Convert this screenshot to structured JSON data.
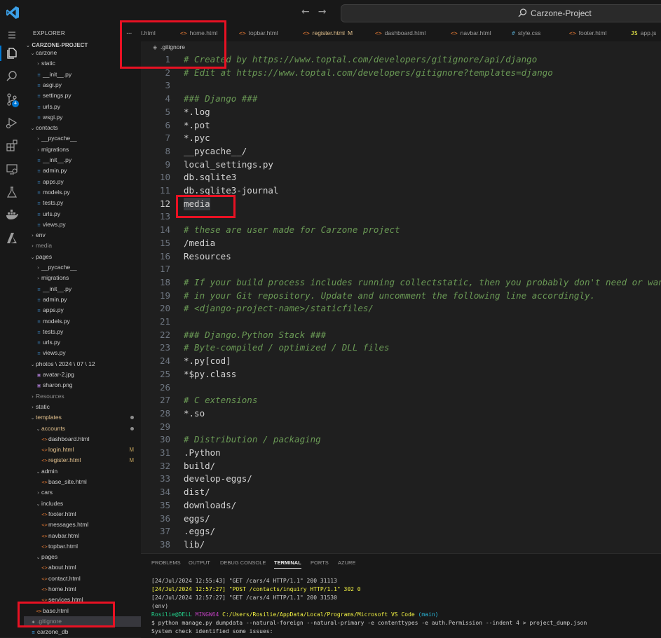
{
  "title_bar": {
    "search_text": "Carzone-Project",
    "back_icon": "arrow-left-icon",
    "forward_icon": "arrow-right-icon"
  },
  "activity_bar": [
    "menu-icon",
    "explorer-icon",
    "search-icon",
    "source-control-icon",
    "run-debug-icon",
    "extensions-icon",
    "remote-explorer-icon",
    "testing-icon",
    "docker-icon",
    "azure-icon"
  ],
  "source_control_badge": "4",
  "sidebar": {
    "title": "EXPLORER",
    "project": "CARZONE-PROJECT",
    "tree": [
      {
        "label": "carzone",
        "type": "folder",
        "open": true,
        "indent": 1
      },
      {
        "label": "static",
        "type": "folder",
        "open": false,
        "indent": 2
      },
      {
        "label": "__init__.py",
        "type": "py",
        "indent": 2
      },
      {
        "label": "asgi.py",
        "type": "py",
        "indent": 2
      },
      {
        "label": "settings.py",
        "type": "py",
        "indent": 2
      },
      {
        "label": "urls.py",
        "type": "py",
        "indent": 2
      },
      {
        "label": "wsgi.py",
        "type": "py",
        "indent": 2
      },
      {
        "label": "contacts",
        "type": "folder",
        "open": true,
        "indent": 1
      },
      {
        "label": "__pycache__",
        "type": "folder",
        "open": false,
        "indent": 2
      },
      {
        "label": "migrations",
        "type": "folder",
        "open": false,
        "indent": 2
      },
      {
        "label": "__init__.py",
        "type": "py",
        "indent": 2
      },
      {
        "label": "admin.py",
        "type": "py",
        "indent": 2
      },
      {
        "label": "apps.py",
        "type": "py",
        "indent": 2
      },
      {
        "label": "models.py",
        "type": "py",
        "indent": 2
      },
      {
        "label": "tests.py",
        "type": "py",
        "indent": 2
      },
      {
        "label": "urls.py",
        "type": "py",
        "indent": 2
      },
      {
        "label": "views.py",
        "type": "py",
        "indent": 2
      },
      {
        "label": "env",
        "type": "folder",
        "open": false,
        "indent": 1
      },
      {
        "label": "media",
        "type": "folder-dim",
        "open": false,
        "indent": 1
      },
      {
        "label": "pages",
        "type": "folder",
        "open": true,
        "indent": 1
      },
      {
        "label": "__pycache__",
        "type": "folder",
        "open": false,
        "indent": 2
      },
      {
        "label": "migrations",
        "type": "folder",
        "open": false,
        "indent": 2
      },
      {
        "label": "__init__.py",
        "type": "py",
        "indent": 2
      },
      {
        "label": "admin.py",
        "type": "py",
        "indent": 2
      },
      {
        "label": "apps.py",
        "type": "py",
        "indent": 2
      },
      {
        "label": "models.py",
        "type": "py",
        "indent": 2
      },
      {
        "label": "tests.py",
        "type": "py",
        "indent": 2
      },
      {
        "label": "urls.py",
        "type": "py",
        "indent": 2
      },
      {
        "label": "views.py",
        "type": "py",
        "indent": 2
      },
      {
        "label": "photos \\ 2024 \\ 07 \\ 12",
        "type": "folder",
        "open": true,
        "indent": 1
      },
      {
        "label": "avatar-2.jpg",
        "type": "img",
        "indent": 2
      },
      {
        "label": "sharon.png",
        "type": "img",
        "indent": 2
      },
      {
        "label": "Resources",
        "type": "folder-dim",
        "open": false,
        "indent": 1
      },
      {
        "label": "static",
        "type": "folder",
        "open": false,
        "indent": 1
      },
      {
        "label": "templates",
        "type": "folder-mod",
        "open": true,
        "indent": 1,
        "dot": true
      },
      {
        "label": "accounts",
        "type": "folder-mod",
        "open": true,
        "indent": 2,
        "dot": true
      },
      {
        "label": "dashboard.html",
        "type": "html",
        "indent": 3
      },
      {
        "label": "login.html",
        "type": "html-mod",
        "indent": 3,
        "mod": "M"
      },
      {
        "label": "register.html",
        "type": "html-mod",
        "indent": 3,
        "mod": "M"
      },
      {
        "label": "admin",
        "type": "folder",
        "open": true,
        "indent": 2
      },
      {
        "label": "base_site.html",
        "type": "html",
        "indent": 3
      },
      {
        "label": "cars",
        "type": "folder",
        "open": false,
        "indent": 2
      },
      {
        "label": "includes",
        "type": "folder",
        "open": true,
        "indent": 2
      },
      {
        "label": "footer.html",
        "type": "html",
        "indent": 3
      },
      {
        "label": "messages.html",
        "type": "html",
        "indent": 3
      },
      {
        "label": "navbar.html",
        "type": "html",
        "indent": 3
      },
      {
        "label": "topbar.html",
        "type": "html",
        "indent": 3
      },
      {
        "label": "pages",
        "type": "folder",
        "open": true,
        "indent": 2
      },
      {
        "label": "about.html",
        "type": "html",
        "indent": 3
      },
      {
        "label": "contact.html",
        "type": "html",
        "indent": 3
      },
      {
        "label": "home.html",
        "type": "html",
        "indent": 3
      },
      {
        "label": "services.html",
        "type": "html",
        "indent": 3
      },
      {
        "label": "base.html",
        "type": "html",
        "indent": 2
      },
      {
        "label": ".gitignore",
        "type": "git",
        "indent": 1,
        "selected": true
      },
      {
        "label": "carzone_db",
        "type": "db",
        "indent": 1
      }
    ]
  },
  "more_actions": "...",
  "tabs": [
    {
      "label": "t.html",
      "icon": "<>"
    },
    {
      "label": "home.html",
      "icon": "<>"
    },
    {
      "label": "topbar.html",
      "icon": "<>"
    },
    {
      "label": "register.html",
      "icon": "<>",
      "active": true,
      "badge": "M"
    },
    {
      "label": "dashboard.html",
      "icon": "<>"
    },
    {
      "label": "navbar.html",
      "icon": "<>"
    },
    {
      "label": "style.css",
      "icon": "#"
    },
    {
      "label": "footer.html",
      "icon": "<>"
    },
    {
      "label": "app.js",
      "icon": "JS"
    }
  ],
  "breadcrumb": ".gitignore",
  "editor": {
    "current_line": 12,
    "lines": [
      {
        "n": "1",
        "text": "# Created by https://www.toptal.com/developers/gitignore/api/django",
        "comment": true
      },
      {
        "n": "2",
        "text": "# Edit at https://www.toptal.com/developers/gitignore?templates=django",
        "comment": true
      },
      {
        "n": "3",
        "text": ""
      },
      {
        "n": "4",
        "text": "### Django ###",
        "comment": true
      },
      {
        "n": "5",
        "text": "*.log"
      },
      {
        "n": "6",
        "text": "*.pot"
      },
      {
        "n": "7",
        "text": "*.pyc"
      },
      {
        "n": "8",
        "text": "__pycache__/"
      },
      {
        "n": "9",
        "text": "local_settings.py"
      },
      {
        "n": "10",
        "text": "db.sqlite3"
      },
      {
        "n": "11",
        "text": "db.sqlite3-journal"
      },
      {
        "n": "12",
        "text": "media",
        "highlight": true
      },
      {
        "n": "13",
        "text": ""
      },
      {
        "n": "14",
        "text": "# these are user made for Carzone project",
        "comment": true
      },
      {
        "n": "15",
        "text": "/media"
      },
      {
        "n": "16",
        "text": "Resources"
      },
      {
        "n": "17",
        "text": ""
      },
      {
        "n": "18",
        "text": "# If your build process includes running collectstatic, then you probably don't need or want",
        "comment": true
      },
      {
        "n": "19",
        "text": "# in your Git repository. Update and uncomment the following line accordingly.",
        "comment": true
      },
      {
        "n": "20",
        "text": "# <django-project-name>/staticfiles/",
        "comment": true
      },
      {
        "n": "21",
        "text": ""
      },
      {
        "n": "22",
        "text": "### Django.Python Stack ###",
        "comment": true
      },
      {
        "n": "23",
        "text": "# Byte-compiled / optimized / DLL files",
        "comment": true
      },
      {
        "n": "24",
        "text": "*.py[cod]"
      },
      {
        "n": "25",
        "text": "*$py.class"
      },
      {
        "n": "26",
        "text": ""
      },
      {
        "n": "27",
        "text": "# C extensions",
        "comment": true
      },
      {
        "n": "28",
        "text": "*.so"
      },
      {
        "n": "29",
        "text": ""
      },
      {
        "n": "30",
        "text": "# Distribution / packaging",
        "comment": true
      },
      {
        "n": "31",
        "text": ".Python"
      },
      {
        "n": "32",
        "text": "build/"
      },
      {
        "n": "33",
        "text": "develop-eggs/"
      },
      {
        "n": "34",
        "text": "dist/"
      },
      {
        "n": "35",
        "text": "downloads/"
      },
      {
        "n": "36",
        "text": "eggs/"
      },
      {
        "n": "37",
        "text": ".eggs/"
      },
      {
        "n": "38",
        "text": "lib/"
      }
    ]
  },
  "panel": {
    "tabs": [
      "PROBLEMS",
      "OUTPUT",
      "DEBUG CONSOLE",
      "TERMINAL",
      "PORTS",
      "AZURE"
    ],
    "active_tab": "TERMINAL",
    "terminal": {
      "line1": "[24/Jul/2024 12:55:43] \"GET /cars/4 HTTP/1.1\" 200 31113",
      "line2": "[24/Jul/2024 12:57:27] \"POST /contacts/inquiry HTTP/1.1\" 302 0",
      "line3": "[24/Jul/2024 12:57:27] \"GET /cars/4 HTTP/1.1\" 200 31530",
      "line4": "(env)",
      "prompt_user": "Rosilie@DELL",
      "prompt_shell": "MINGW64",
      "prompt_path": "C:/Users/Rosilie/AppData/Local/Programs/Microsoft VS Code",
      "prompt_branch": "(main)",
      "command": "$ python manage.py dumpdata --natural-foreign --natural-primary -e contenttypes -e auth.Permission --indent 4 > project_dump.json",
      "output": "System check identified some issues:"
    }
  },
  "colors": {
    "accent": "#0078d4",
    "annotation": "#e81123",
    "modified": "#e2c08d",
    "comment": "#6a9955"
  }
}
